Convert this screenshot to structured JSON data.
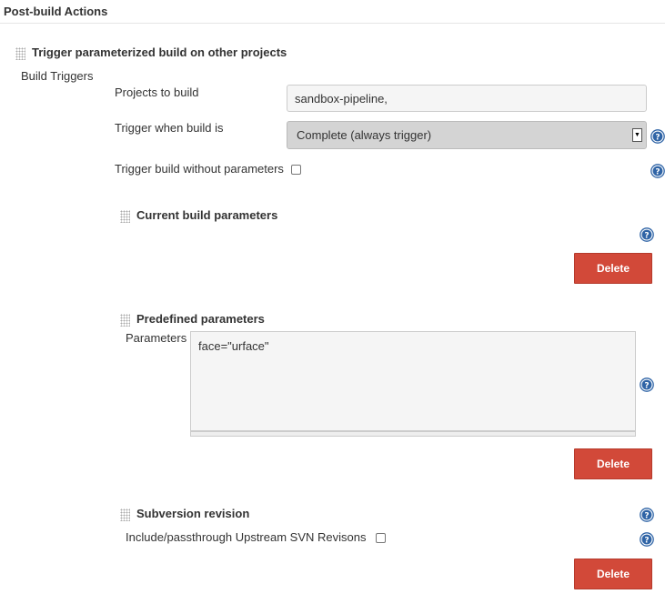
{
  "section": {
    "title": "Post-build Actions"
  },
  "trigger": {
    "title": "Trigger parameterized build on other projects",
    "build_triggers_label": "Build Triggers",
    "projects_label": "Projects to build",
    "projects_value": "sandbox-pipeline,",
    "when_label": "Trigger when build is",
    "when_value": "Complete (always trigger)",
    "without_params_label": "Trigger build without parameters"
  },
  "current": {
    "title": "Current build parameters",
    "delete_label": "Delete"
  },
  "predefined": {
    "title": "Predefined parameters",
    "params_label": "Parameters",
    "params_value": "face=\"urface\"",
    "delete_label": "Delete"
  },
  "svn": {
    "title": "Subversion revision",
    "include_label": "Include/passthrough Upstream SVN Revisons",
    "delete_label": "Delete"
  },
  "colors": {
    "delete_button": "#d24939",
    "help_icon": "#2f64a6",
    "select_bg": "#d4d4d4"
  },
  "icons": {
    "help": "help-icon",
    "drag": "drag-handle-icon",
    "dropdown": "chevron-down-icon"
  }
}
